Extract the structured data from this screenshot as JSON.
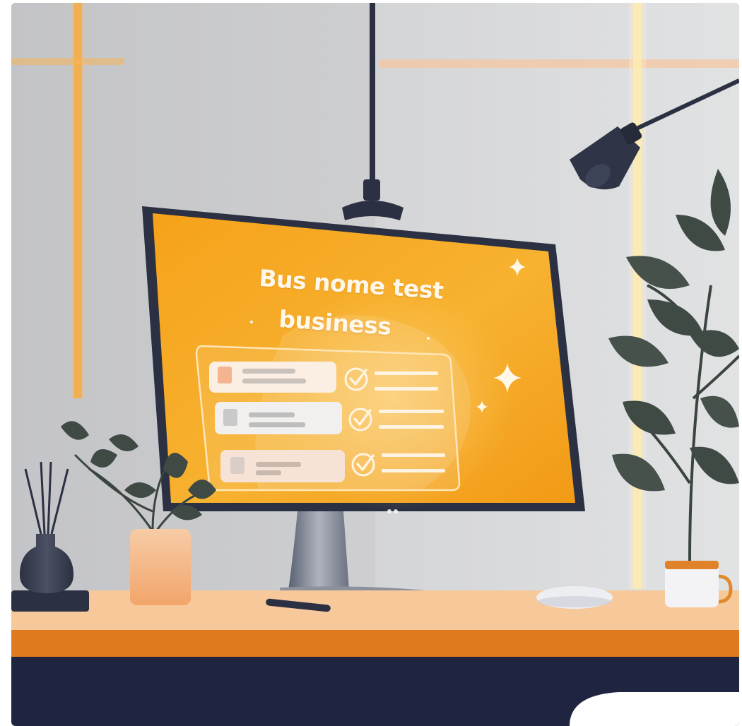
{
  "screen": {
    "title_line_1": "Bus nome test",
    "title_line_2": "business"
  },
  "checklist": {
    "rows": [
      {
        "state": "checked",
        "accent": "#f4b48f"
      },
      {
        "state": "checked",
        "accent": "#c9c9c9"
      },
      {
        "state": "checked",
        "accent": "#d9cfc8"
      }
    ]
  },
  "colors": {
    "wall": "#cfd0d2",
    "screen_orange": "#f5a21f",
    "desk_top": "#f7c89a",
    "desk_edge": "#e07a1f",
    "floor": "#1f2540",
    "monitor_frame": "#2b3142",
    "plant_leaf": "#3f4a45"
  },
  "icons": [
    "sparkle-icon",
    "check-circle-icon",
    "lamp-icon",
    "plant-icon",
    "diffuser-icon",
    "mouse-icon",
    "mug-icon",
    "pen-icon"
  ]
}
